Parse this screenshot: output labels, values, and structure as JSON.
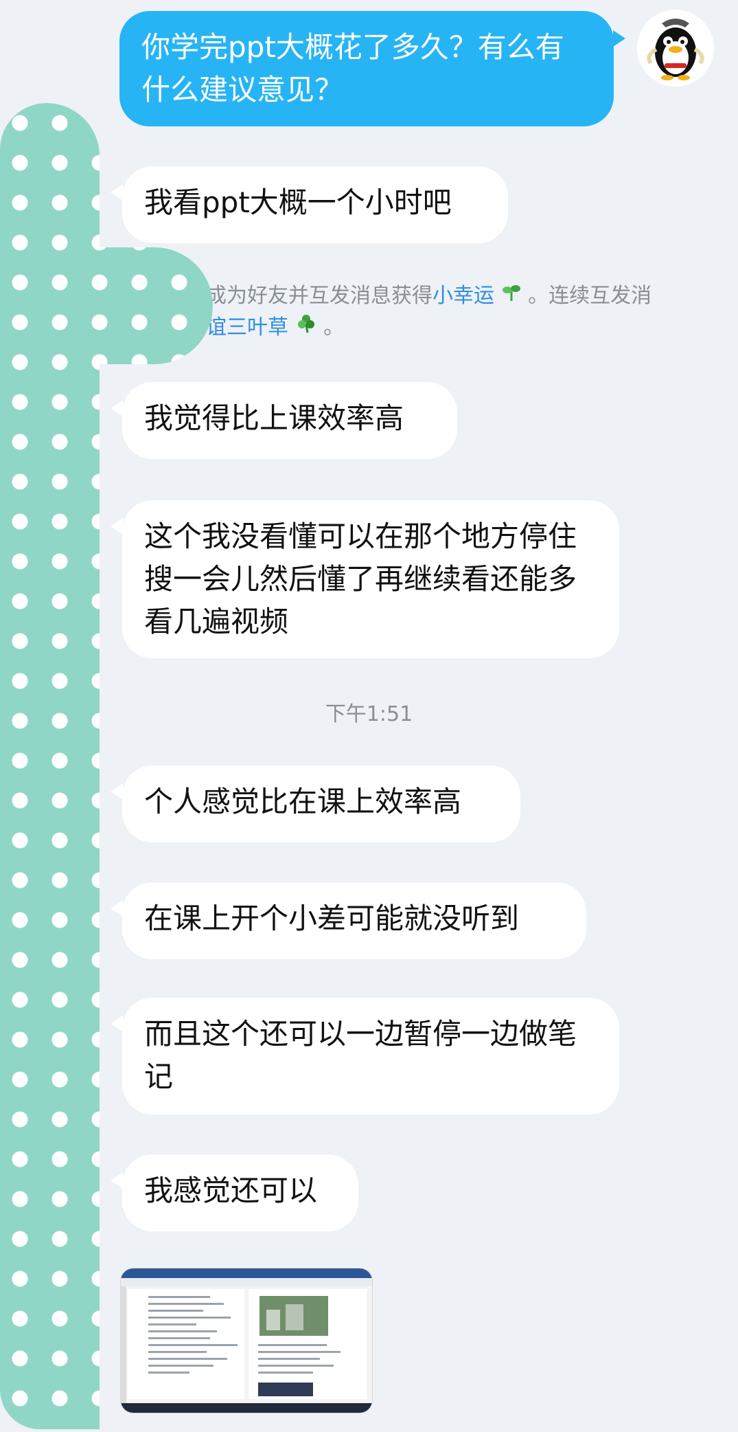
{
  "messages": [
    {
      "id": "m1",
      "side": "out",
      "text": "你学完ppt大概花了多久？有么有什么建议意见？"
    },
    {
      "id": "m2",
      "side": "in",
      "text": "我看ppt大概一个小时吧"
    },
    {
      "id": "m3",
      "side": "in",
      "text": "我觉得比上课效率高"
    },
    {
      "id": "m4",
      "side": "in",
      "text": "这个我没看懂可以在那个地方停住 搜一会儿然后懂了再继续看还能多看几遍视频"
    },
    {
      "id": "m5",
      "side": "in",
      "text": "个人感觉比在课上效率高"
    },
    {
      "id": "m6",
      "side": "in",
      "text": "在课上开个小差可能就没听到"
    },
    {
      "id": "m7",
      "side": "in",
      "text": "而且这个还可以一边暂停一边做笔记"
    },
    {
      "id": "m8",
      "side": "in",
      "text": "我感觉还可以"
    }
  ],
  "system_notice": {
    "line1_prefix": "成为好友并互发消息获得",
    "line1_link": "小幸运",
    "line1_suffix": "。连续互发消",
    "line2_link": "谊三叶草",
    "line2_suffix": "。"
  },
  "timestamp": "下午1:51",
  "colors": {
    "outgoing_bubble": "#27b4f5",
    "incoming_bubble": "#ffffff",
    "background": "#eef1f6",
    "link": "#2f8ee0"
  },
  "icons": {
    "avatar": "penguin-avatar-icon",
    "sprout": "sprout-icon",
    "clover": "clover-icon"
  },
  "attachment": {
    "kind": "image-thumbnail",
    "description_visible": false
  }
}
